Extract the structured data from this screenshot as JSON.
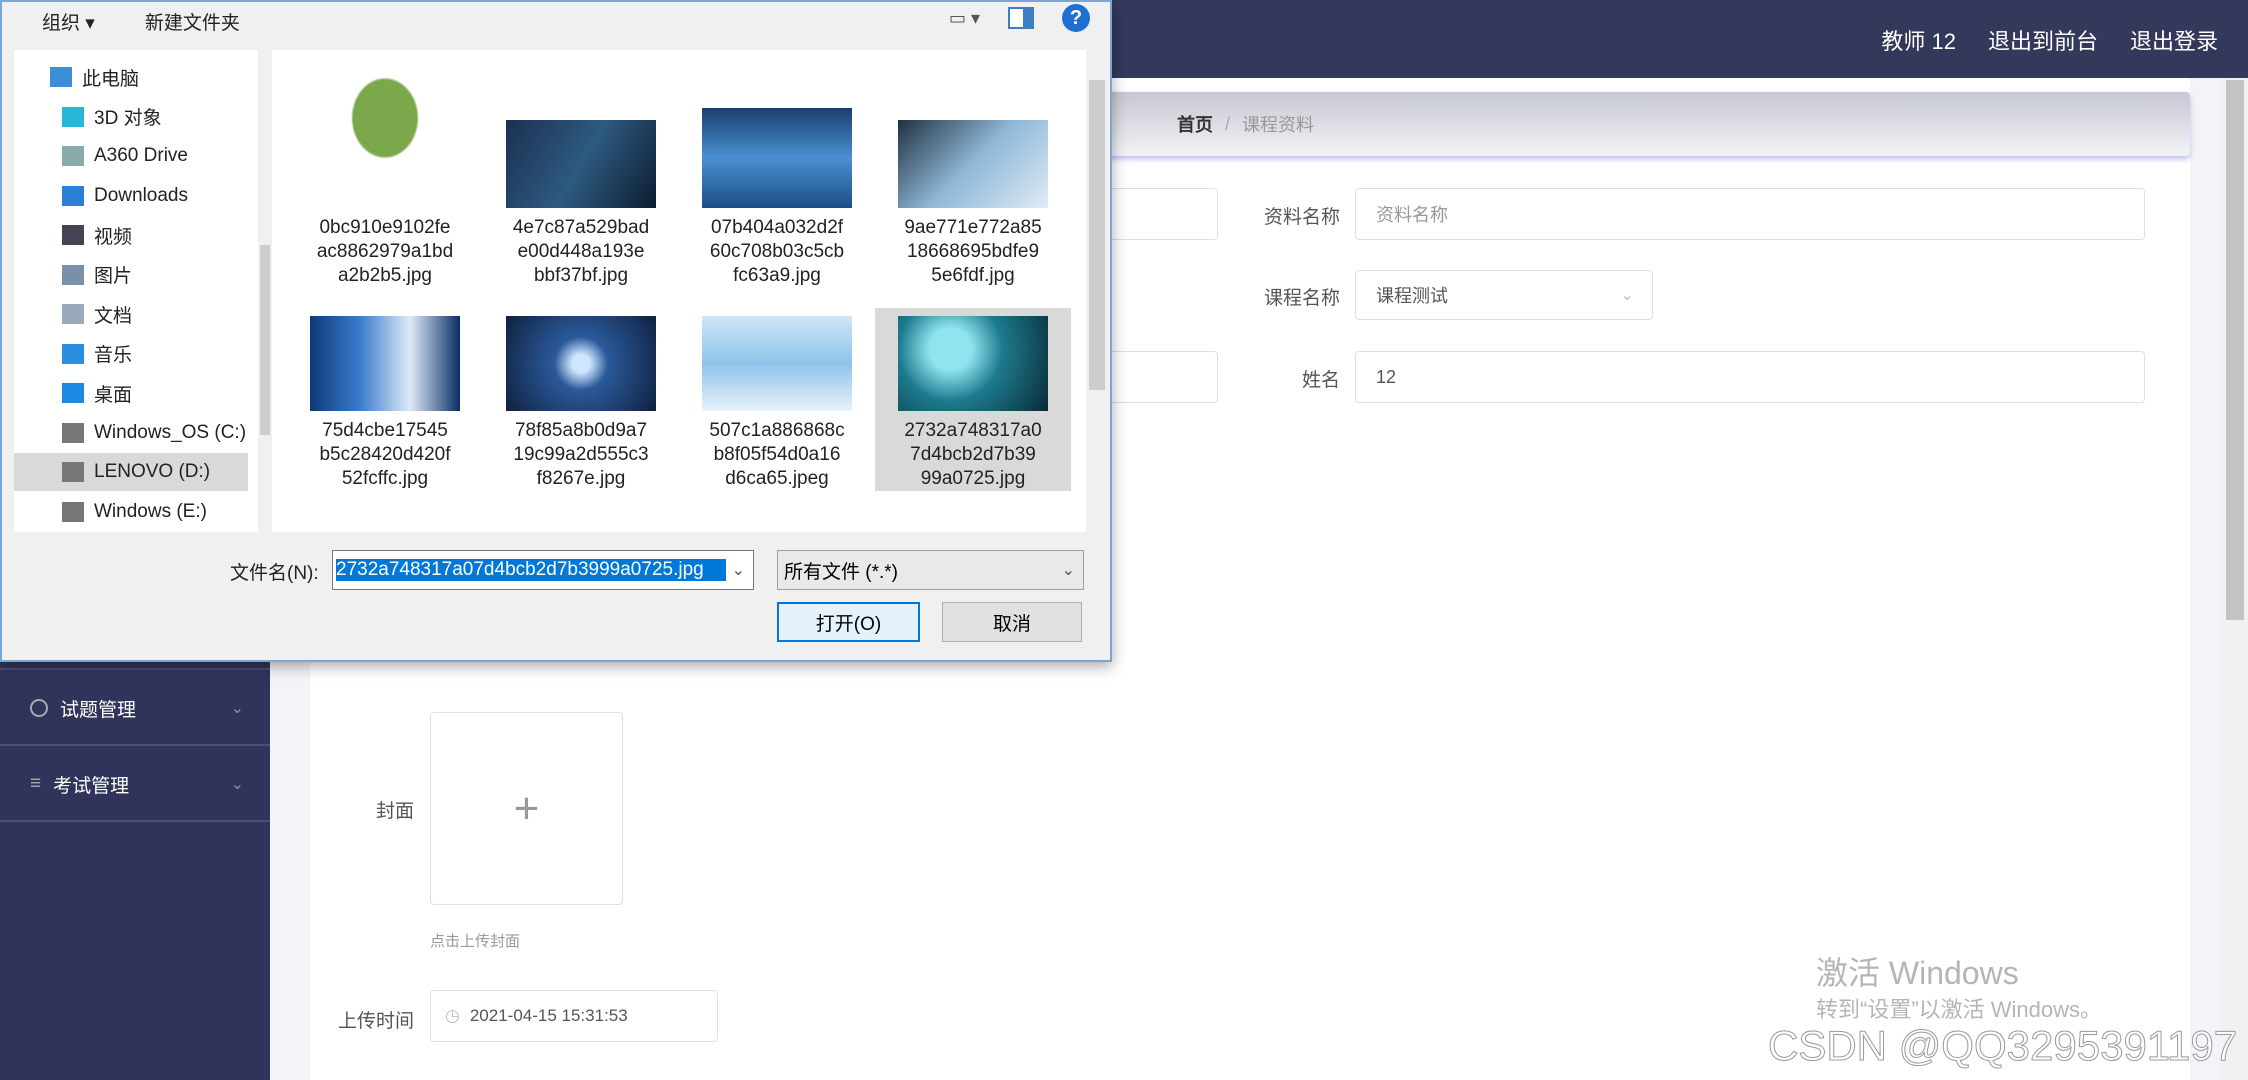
{
  "header": {
    "user": "教师 12",
    "to_front": "退出到前台",
    "logout": "退出登录"
  },
  "sidebar": {
    "items": [
      {
        "label": "试题管理",
        "icon": "gauge-icon"
      },
      {
        "label": "考试管理",
        "icon": "list-icon"
      }
    ]
  },
  "breadcrumb": {
    "home": "首页",
    "separator": "/",
    "current": "课程资料"
  },
  "form": {
    "material_name": {
      "label": "资料名称",
      "placeholder": "资料名称"
    },
    "course_name": {
      "label": "课程名称",
      "value": "课程测试"
    },
    "name": {
      "label": "姓名",
      "value": "12"
    },
    "cover": {
      "label": "封面",
      "hint": "点击上传封面"
    },
    "upload_time": {
      "label": "上传时间",
      "value": "2021-04-15 15:31:53"
    }
  },
  "watermark": {
    "line1": "激活 Windows",
    "line2": "转到“设置”以激活 Windows。",
    "csdn": "CSDN @QQ3295391197"
  },
  "dialog": {
    "toolbar": {
      "organize": "组织 ▾",
      "new_folder": "新建文件夹"
    },
    "nav": [
      {
        "label": "此电脑",
        "icon": "computer-icon",
        "color": "#3a8fd8",
        "indent": false
      },
      {
        "label": "3D 对象",
        "icon": "3d-objects-icon",
        "color": "#29b6d8",
        "indent": true
      },
      {
        "label": "A360 Drive",
        "icon": "cloud-drive-icon",
        "color": "#8aa",
        "indent": true
      },
      {
        "label": "Downloads",
        "icon": "download-icon",
        "color": "#2a7fd6",
        "indent": true
      },
      {
        "label": "视频",
        "icon": "video-icon",
        "color": "#445",
        "indent": true
      },
      {
        "label": "图片",
        "icon": "pictures-icon",
        "color": "#7a8fa8",
        "indent": true
      },
      {
        "label": "文档",
        "icon": "documents-icon",
        "color": "#9ab",
        "indent": true
      },
      {
        "label": "音乐",
        "icon": "music-icon",
        "color": "#2a8fe0",
        "indent": true
      },
      {
        "label": "桌面",
        "icon": "desktop-icon",
        "color": "#1e88e5",
        "indent": true
      },
      {
        "label": "Windows_OS (C:)",
        "icon": "drive-icon",
        "color": "#777",
        "indent": true
      },
      {
        "label": "LENOVO (D:)",
        "icon": "drive-icon",
        "color": "#777",
        "indent": true,
        "selected": true
      },
      {
        "label": "Windows (E:)",
        "icon": "drive-icon",
        "color": "#777",
        "indent": true
      }
    ],
    "files": [
      {
        "name": "0bc910e9102feac8862979a1bda2b2b5.jpg",
        "lines": [
          "0bc910e9102fe",
          "ac8862979a1bd",
          "a2b2b5.jpg"
        ],
        "bg": "radial-gradient(ellipse at 50% 40%,#7aa84a 0 30%,#fff 32%)"
      },
      {
        "name": "4e7c87a529bade00d448a193ebbf37bf.jpg",
        "lines": [
          "4e7c87a529bad",
          "e00d448a193e",
          "bbf37bf.jpg"
        ],
        "bg": "linear-gradient(120deg,#1c3050,#2d5a80,#0e1c30)"
      },
      {
        "name": "07b404a032d2f60c708b03c5cbfc63a9.jpg",
        "lines": [
          "07b404a032d2f",
          "60c708b03c5cb",
          "fc63a9.jpg"
        ],
        "bg": "linear-gradient(180deg,#1a3e70,#4a90d0,#1b4e88)"
      },
      {
        "name": "9ae771e772a8518668695bdfe95e6fdf.jpg",
        "lines": [
          "9ae771e772a85",
          "18668695bdfe9",
          "5e6fdf.jpg"
        ],
        "bg": "linear-gradient(135deg,#203040,#90b8d8,#e0ecf6)"
      },
      {
        "name": "75d4cbe17545b5c28420d420f52fcffc.jpg",
        "lines": [
          "75d4cbe17545",
          "b5c28420d420f",
          "52fcffc.jpg"
        ],
        "bg": "linear-gradient(90deg,#0d3a7a,#3b7ccc,#dfeaf8,#0b2d66)"
      },
      {
        "name": "78f85a8b0d9a719c99a2d555c3f8267e.jpg",
        "lines": [
          "78f85a8b0d9a7",
          "19c99a2d555c3",
          "f8267e.jpg"
        ],
        "bg": "radial-gradient(circle at 50% 50%,#cfe6ff 0 10%,#2a5a9a 30%,#102040)"
      },
      {
        "name": "507c1a886868cb8f05f54d0a16d6ca65.jpeg",
        "lines": [
          "507c1a886868c",
          "b8f05f54d0a16",
          "d6ca65.jpeg"
        ],
        "bg": "linear-gradient(180deg,#cfe6f6,#8ec3ea,#e8f3fb)"
      },
      {
        "name": "2732a748317a07d4bcb2d7b3999a0725.jpg",
        "lines": [
          "2732a748317a0",
          "7d4bcb2d7b39",
          "99a0725.jpg"
        ],
        "bg": "radial-gradient(circle at 35% 35%,#8fe4f0 0 18%,#1d7a8e 45%,#082a34)",
        "selected": true
      }
    ],
    "filename_label": "文件名(N):",
    "filename_value": "2732a748317a07d4bcb2d7b3999a0725.jpg",
    "filter_value": "所有文件 (*.*)",
    "open_button": "打开(O)",
    "cancel_button": "取消"
  }
}
